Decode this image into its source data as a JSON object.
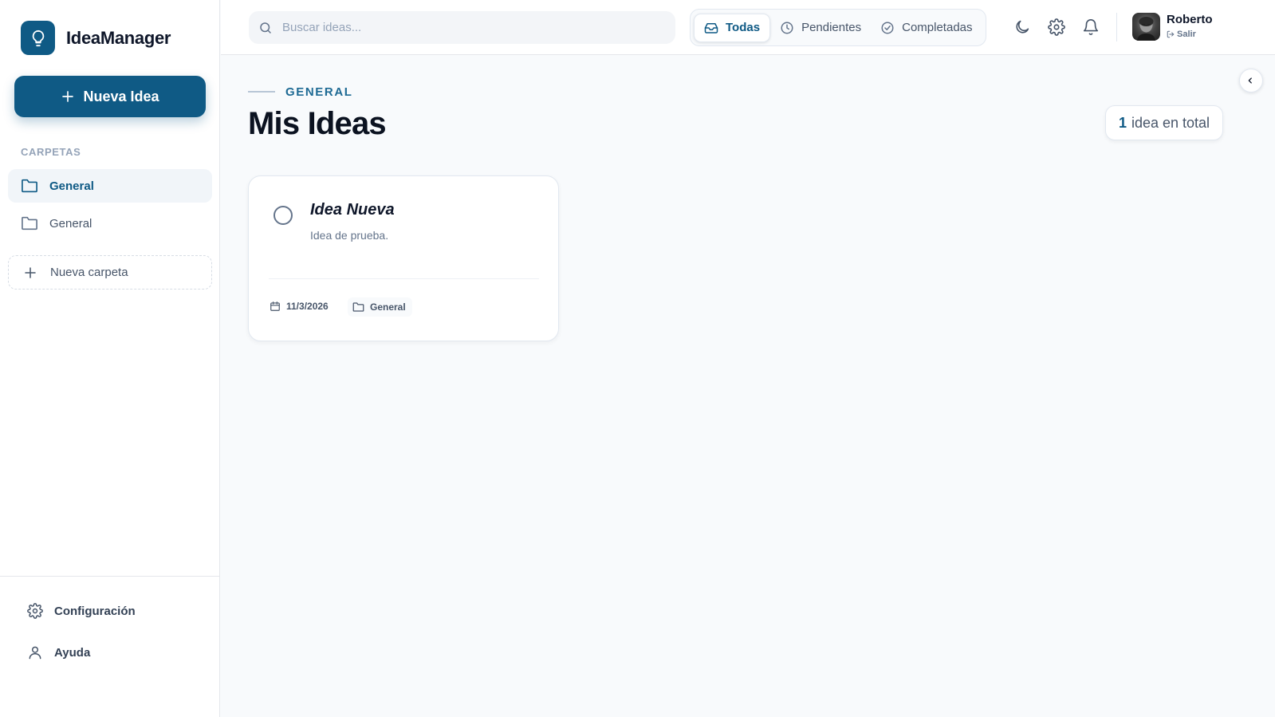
{
  "app": {
    "name": "IdeaManager"
  },
  "sidebar": {
    "new_idea_label": "Nueva Idea",
    "folders_heading": "CARPETAS",
    "folders": [
      {
        "label": "General",
        "active": true
      },
      {
        "label": "General",
        "active": false
      }
    ],
    "new_folder_label": "Nueva carpeta",
    "footer": {
      "settings_label": "Configuración",
      "help_label": "Ayuda"
    }
  },
  "header": {
    "search_placeholder": "Buscar ideas...",
    "filters": [
      {
        "label": "Todas",
        "icon": "inbox-icon",
        "active": true
      },
      {
        "label": "Pendientes",
        "icon": "clock-icon",
        "active": false
      },
      {
        "label": "Completadas",
        "icon": "check-circle-icon",
        "active": false
      }
    ],
    "icons": [
      "moon-icon",
      "gear-icon",
      "bell-icon"
    ],
    "user": {
      "name": "Roberto",
      "logout_label": "Salir"
    }
  },
  "main": {
    "breadcrumb": "GENERAL",
    "title": "Mis Ideas",
    "total": {
      "count": "1",
      "suffix": "idea en total"
    },
    "ideas": [
      {
        "title": "Idea Nueva",
        "description": "Idea de prueba.",
        "date": "11/3/2026",
        "folder": "General",
        "completed": false
      }
    ]
  },
  "colors": {
    "brand": "#0f5a85",
    "background": "#f8fafc",
    "text": "#0f172a",
    "muted": "#64748b"
  }
}
